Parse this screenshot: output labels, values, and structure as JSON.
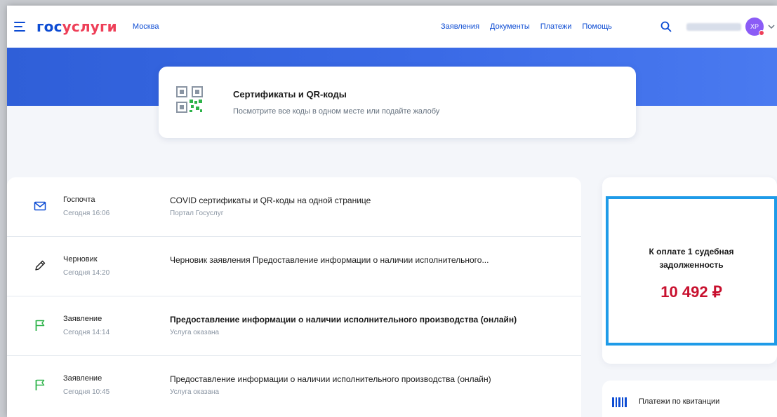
{
  "header": {
    "logo_part1": "гос",
    "logo_part2": "услуги",
    "city": "Москва",
    "nav": [
      "Заявления",
      "Документы",
      "Платежи",
      "Помощь"
    ],
    "avatar_initials": "ХР"
  },
  "promo": {
    "title": "Сертификаты и QR-коды",
    "subtitle": "Посмотрите все коды в одном месте или подайте жалобу"
  },
  "feed": [
    {
      "type": "Госпочта",
      "time": "Сегодня 16:06",
      "title": "COVID сертификаты и QR-коды на одной странице",
      "subtitle": "Портал Госуслуг",
      "icon": "mail-icon",
      "bold": false
    },
    {
      "type": "Черновик",
      "time": "Сегодня 14:20",
      "title": "Черновик заявления Предоставление информации о наличии исполнительного...",
      "subtitle": "",
      "icon": "pencil-icon",
      "bold": false
    },
    {
      "type": "Заявление",
      "time": "Сегодня 14:14",
      "title": "Предоставление информации о наличии исполнительного производства (онлайн)",
      "subtitle": "Услуга оказана",
      "icon": "flag-icon",
      "bold": true
    },
    {
      "type": "Заявление",
      "time": "Сегодня 10:45",
      "title": "Предоставление информации о наличии исполнительного производства (онлайн)",
      "subtitle": "Услуга оказана",
      "icon": "flag-icon",
      "bold": false
    }
  ],
  "debt": {
    "label": "К оплате 1 судебная задолженность",
    "amount": "10 492 ₽"
  },
  "payments": {
    "label": "Платежи по квитанции"
  },
  "colors": {
    "brand_blue": "#0d4cd3",
    "brand_red": "#ee3f58",
    "amount_red": "#c8102e",
    "highlight": "#1e9be8",
    "flag_green": "#2eb34a"
  }
}
